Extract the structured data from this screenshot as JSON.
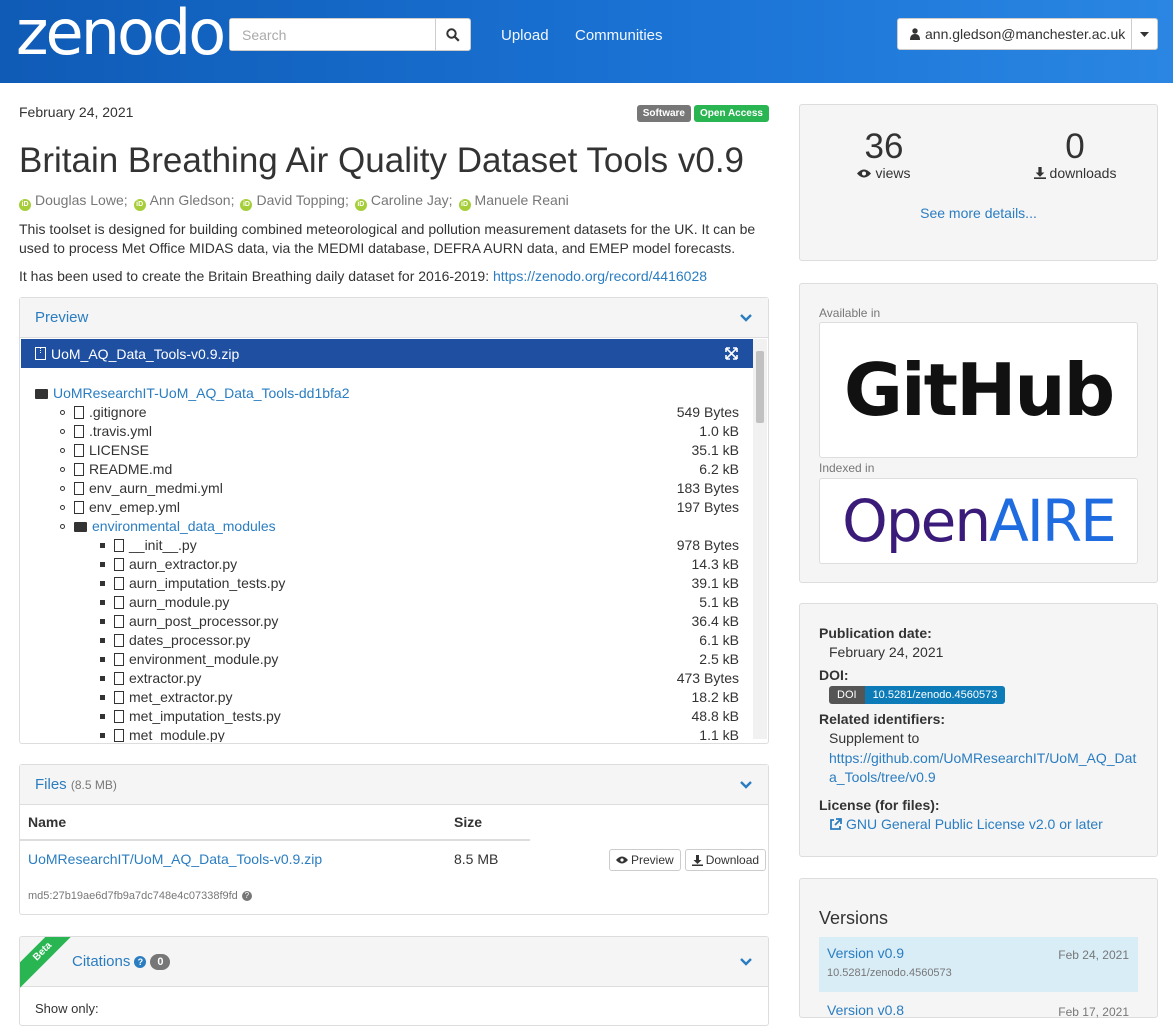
{
  "header": {
    "logo": "zenodo",
    "search_placeholder": "Search",
    "nav": [
      "Upload",
      "Communities"
    ],
    "user": "ann.gledson@manchester.ac.uk"
  },
  "record": {
    "date": "February 24, 2021",
    "badges": [
      {
        "label": "Software",
        "color": "#777777"
      },
      {
        "label": "Open Access",
        "color": "#2ab553"
      }
    ],
    "title": "Britain Breathing Air Quality Dataset Tools v0.9",
    "authors": [
      "Douglas Lowe;",
      "Ann Gledson;",
      "David Topping;",
      "Caroline Jay;",
      "Manuele Reani"
    ],
    "description": "This toolset is designed for building combined meteorological and pollution measurement datasets for the UK. It can be used to process Met Office MIDAS data, via the MEDMI database, DEFRA AURN data, and EMEP model forecasts.",
    "usage_prefix": "It has been used to create the Britain Breathing daily dataset for 2016-2019: ",
    "usage_link": "https://zenodo.org/record/4416028"
  },
  "preview": {
    "title": "Preview",
    "file": "UoM_AQ_Data_Tools-v0.9.zip",
    "root": "UoMResearchIT-UoM_AQ_Data_Tools-dd1bfa2",
    "items": [
      {
        "name": ".gitignore",
        "size": "549 Bytes",
        "level": 1,
        "type": "file"
      },
      {
        "name": ".travis.yml",
        "size": "1.0 kB",
        "level": 1,
        "type": "file"
      },
      {
        "name": "LICENSE",
        "size": "35.1 kB",
        "level": 1,
        "type": "file"
      },
      {
        "name": "README.md",
        "size": "6.2 kB",
        "level": 1,
        "type": "file"
      },
      {
        "name": "env_aurn_medmi.yml",
        "size": "183 Bytes",
        "level": 1,
        "type": "file"
      },
      {
        "name": "env_emep.yml",
        "size": "197 Bytes",
        "level": 1,
        "type": "file"
      },
      {
        "name": "environmental_data_modules",
        "size": "",
        "level": 1,
        "type": "folder"
      },
      {
        "name": "__init__.py",
        "size": "978 Bytes",
        "level": 2,
        "type": "file"
      },
      {
        "name": "aurn_extractor.py",
        "size": "14.3 kB",
        "level": 2,
        "type": "file"
      },
      {
        "name": "aurn_imputation_tests.py",
        "size": "39.1 kB",
        "level": 2,
        "type": "file"
      },
      {
        "name": "aurn_module.py",
        "size": "5.1 kB",
        "level": 2,
        "type": "file"
      },
      {
        "name": "aurn_post_processor.py",
        "size": "36.4 kB",
        "level": 2,
        "type": "file"
      },
      {
        "name": "dates_processor.py",
        "size": "6.1 kB",
        "level": 2,
        "type": "file"
      },
      {
        "name": "environment_module.py",
        "size": "2.5 kB",
        "level": 2,
        "type": "file"
      },
      {
        "name": "extractor.py",
        "size": "473 Bytes",
        "level": 2,
        "type": "file"
      },
      {
        "name": "met_extractor.py",
        "size": "18.2 kB",
        "level": 2,
        "type": "file"
      },
      {
        "name": "met_imputation_tests.py",
        "size": "48.8 kB",
        "level": 2,
        "type": "file"
      },
      {
        "name": "met_module.py",
        "size": "1.1 kB",
        "level": 2,
        "type": "file"
      }
    ]
  },
  "files": {
    "title": "Files",
    "total": "(8.5 MB)",
    "col_name": "Name",
    "col_size": "Size",
    "file_name": "UoMResearchIT/UoM_AQ_Data_Tools-v0.9.zip",
    "file_size": "8.5 MB",
    "preview_btn": "Preview",
    "download_btn": "Download",
    "md5": "md5:27b19ae6d7fb9a7dc748e4c07338f9fd"
  },
  "citations": {
    "ribbon": "Beta",
    "title": "Citations",
    "count": "0",
    "show_only": "Show only:"
  },
  "stats": {
    "views": "36",
    "views_label": "views",
    "downloads": "0",
    "downloads_label": "downloads",
    "more": "See more details..."
  },
  "integrations": {
    "available_label": "Available in",
    "available_logo": "GitHub",
    "indexed_label": "Indexed in",
    "indexed_logo_a": "Open",
    "indexed_logo_b": "AIRE"
  },
  "meta": {
    "pub_label": "Publication date:",
    "pub_value": "February 24, 2021",
    "doi_label": "DOI:",
    "doi_prefix": "DOI",
    "doi_value": "10.5281/zenodo.4560573",
    "rel_label": "Related identifiers:",
    "rel_text": "Supplement to",
    "rel_link_1": "https://github.com/UoMResearchIT/UoM_AQ_Dat",
    "rel_link_2": "a_Tools/tree/v0.9",
    "license_label": "License (for files):",
    "license_value": "GNU General Public License v2.0 or later"
  },
  "versions": {
    "title": "Versions",
    "items": [
      {
        "name": "Version v0.9",
        "doi": "10.5281/zenodo.4560573",
        "date": "Feb 24, 2021"
      },
      {
        "name": "Version v0.8",
        "doi": "",
        "date": "Feb 17, 2021"
      }
    ]
  }
}
